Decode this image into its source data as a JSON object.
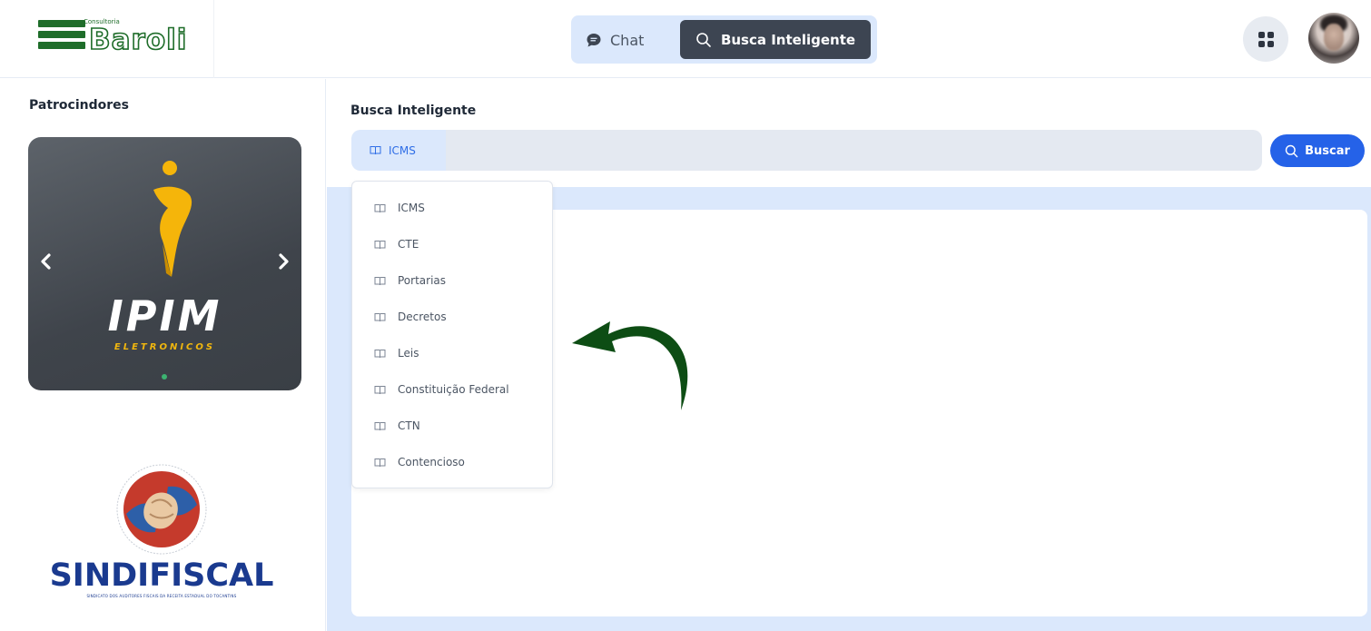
{
  "header": {
    "logo": {
      "text": "Baroli",
      "small_text": "Consultoria"
    },
    "tabs": [
      {
        "label": "Chat",
        "icon": "chat-bubble-icon",
        "active": false
      },
      {
        "label": "Busca Inteligente",
        "icon": "search-icon",
        "active": true
      }
    ],
    "apps_icon": "grid-icon",
    "avatar": "user-avatar"
  },
  "sidebar": {
    "title": "Patrocindores",
    "sponsors": [
      {
        "name": "IPIM",
        "subtitle": "ELETRONICOS",
        "accent": "#f5b50a"
      },
      {
        "name": "SINDIFISCAL",
        "subtitle": "SINDICATO DOS AUDITORES FISCAIS DA RECEITA ESTADUAL DO TOCANTINS",
        "accent": "#1a3a8f"
      }
    ]
  },
  "main": {
    "title": "Busca Inteligente",
    "search": {
      "selected_source": "ICMS",
      "placeholder": "",
      "value": "",
      "button_label": "Buscar"
    },
    "dropdown": {
      "items": [
        "ICMS",
        "CTE",
        "Portarias",
        "Decretos",
        "Leis",
        "Constituição Federal",
        "CTN",
        "Contencioso"
      ]
    }
  },
  "colors": {
    "primary": "#2562e8",
    "active_tab": "#3d4552",
    "light_blue": "#dbe8fc",
    "annotation_arrow": "#0d4d14"
  }
}
